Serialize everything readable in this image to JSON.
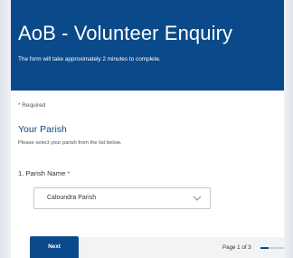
{
  "form": {
    "title": "AoB - Volunteer Enquiry",
    "subtitle": "The form will take approximately 2 minutes to complete."
  },
  "required_note": {
    "star": "*",
    "text": " Required"
  },
  "section": {
    "title": "Your Parish",
    "description": "Please select your parish from the list below."
  },
  "question": {
    "label": "1. Parish Name ",
    "required_star": "*",
    "selected_value": "Caloundra Parish",
    "icon": "chevron-down-icon"
  },
  "footer": {
    "next_label": "Next",
    "page_indicator": "Page 1 of 3",
    "progress_fraction": 0.3333
  },
  "colors": {
    "brand": "#0a4a8a",
    "required": "#c0392b"
  }
}
